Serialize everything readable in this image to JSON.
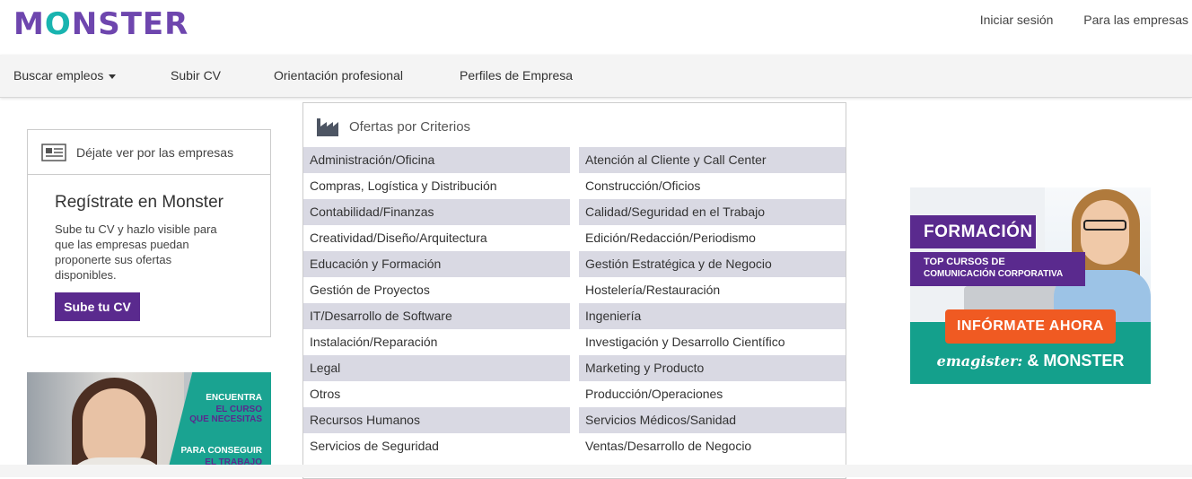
{
  "header": {
    "logo": {
      "part1": "M",
      "o": "O",
      "part2": "NSTER"
    },
    "login": "Iniciar sesión",
    "companies": "Para las empresas"
  },
  "nav": {
    "items": [
      "Buscar empleos",
      "Subir CV",
      "Orientación profesional",
      "Perfiles de Empresa"
    ]
  },
  "register_card": {
    "header": "Déjate ver por las empresas",
    "title": "Regístrate en Monster",
    "text": "Sube tu CV y hazlo visible para que las empresas puedan proponerte sus ofertas disponibles.",
    "button": "Sube tu CV"
  },
  "course_banner": {
    "line1": "ENCUENTRA",
    "line2": "EL CURSO",
    "line3": "QUE NECESITAS",
    "line4": "PARA CONSEGUIR",
    "line5": "EL TRABAJO"
  },
  "criteria": {
    "title": "Ofertas por Criterios",
    "rows": [
      [
        "Administración/Oficina",
        "Atención al Cliente y Call Center"
      ],
      [
        "Compras, Logística y Distribución",
        "Construcción/Oficios"
      ],
      [
        "Contabilidad/Finanzas",
        "Calidad/Seguridad en el Trabajo"
      ],
      [
        "Creatividad/Diseño/Arquitectura",
        "Edición/Redacción/Periodismo"
      ],
      [
        "Educación y Formación",
        "Gestión Estratégica y de Negocio"
      ],
      [
        "Gestión de Proyectos",
        "Hostelería/Restauración"
      ],
      [
        "IT/Desarrollo de Software",
        "Ingeniería"
      ],
      [
        "Instalación/Reparación",
        "Investigación y Desarrollo Científico"
      ],
      [
        "Legal",
        "Marketing y Producto"
      ],
      [
        "Otros",
        "Producción/Operaciones"
      ],
      [
        "Recursos Humanos",
        "Servicios Médicos/Sanidad"
      ],
      [
        "Servicios de Seguridad",
        "Ventas/Desarrollo de Negocio"
      ]
    ]
  },
  "ad": {
    "formacion": "FORMACIÓN",
    "top1": "TOP CURSOS DE",
    "top2": "COMUNICACIÓN CORPORATIVA",
    "cta": "INFÓRMATE AHORA",
    "brand1": "emagister:",
    "brand2": "& MONSTER"
  },
  "colors": {
    "purple": "#6e46ae",
    "teal": "#19b4b0",
    "button": "#5a2a8e",
    "row_shade": "#d9d9e3",
    "cta": "#f05a22"
  }
}
